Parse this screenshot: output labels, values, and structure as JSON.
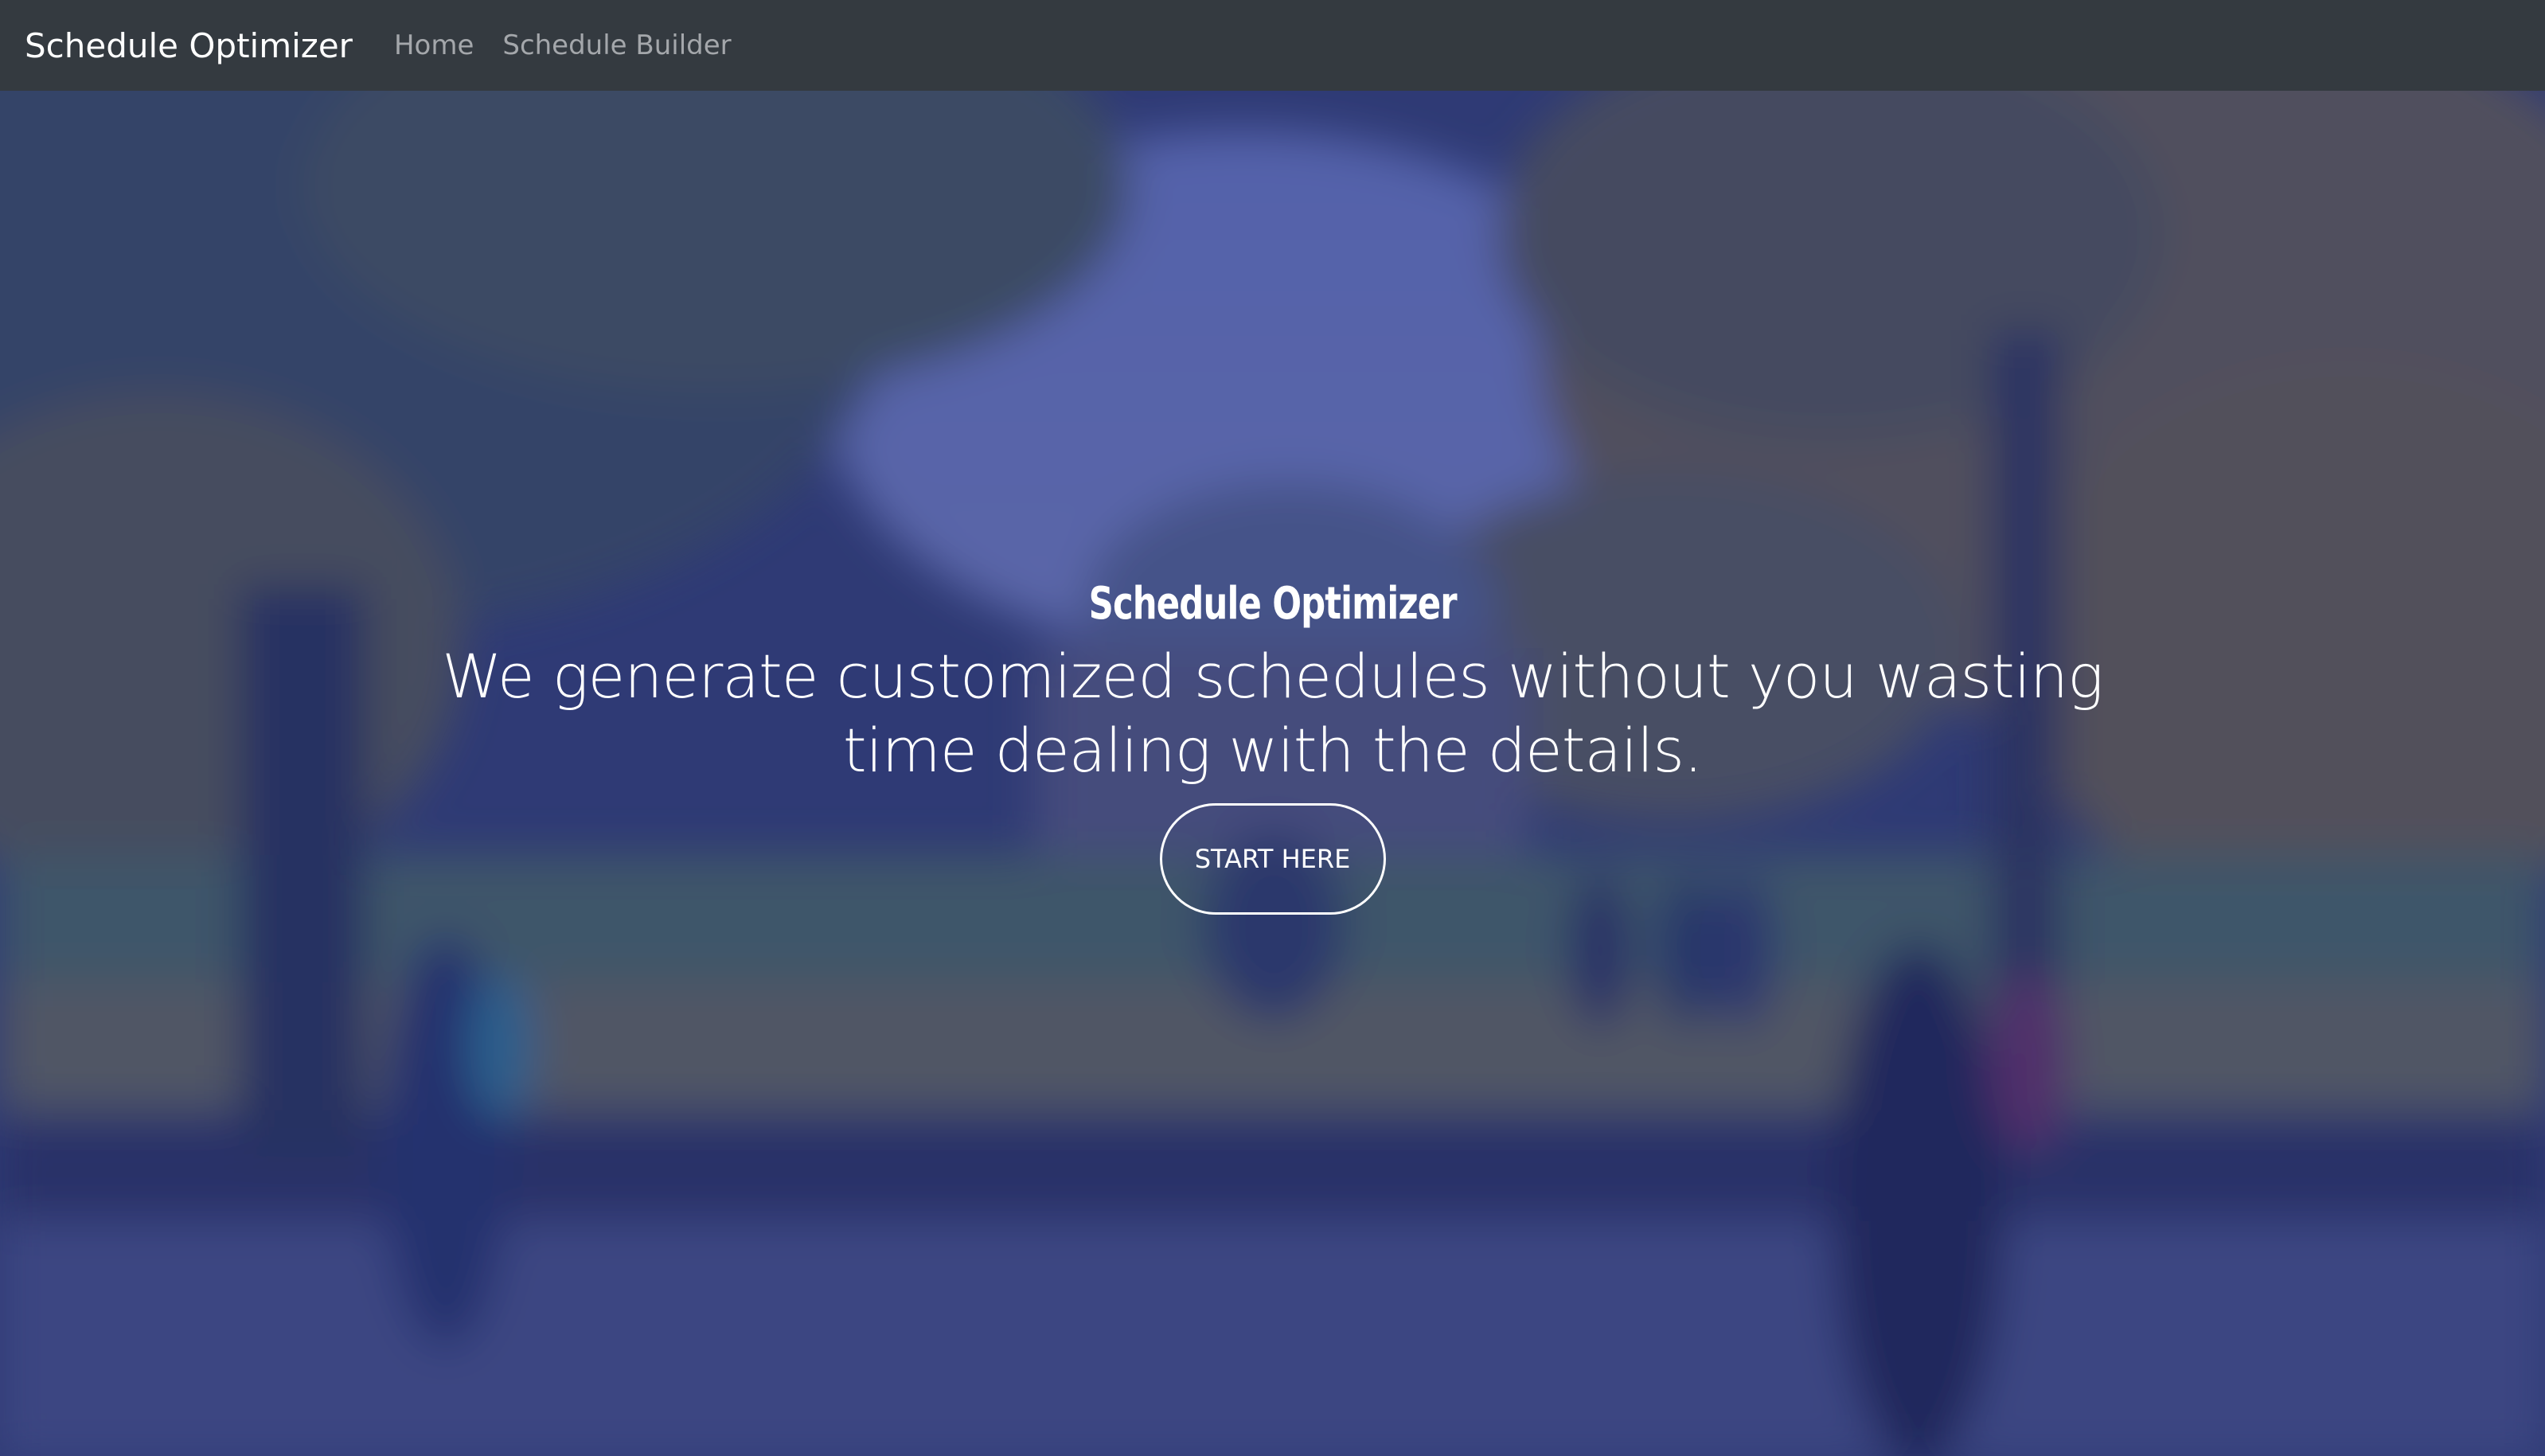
{
  "navbar": {
    "brand": "Schedule Optimizer",
    "links": [
      {
        "label": "Home"
      },
      {
        "label": "Schedule Builder"
      }
    ]
  },
  "hero": {
    "title": "Schedule Optimizer",
    "subtitle": "We generate customized schedules without you wasting time dealing with the details.",
    "cta_label": "START HERE"
  },
  "colors": {
    "navbar_bg": "#343a40",
    "overlay_tint": "#28328a",
    "text": "#ffffff",
    "nav_link": "#a4a7ab"
  }
}
